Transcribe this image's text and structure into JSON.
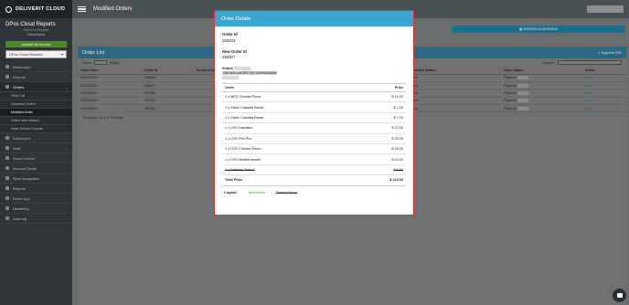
{
  "sidebar": {
    "brand": "DELIVERIT CLOUD",
    "profile_name": "DPos Cloud Reports",
    "profile_sub": "Switch to Reseller",
    "profile_role": "Client Admin",
    "activate_btn": "Activate Vet Account",
    "store_select": "DPos Cloud Reports",
    "items": [
      {
        "label": "Dashboard"
      },
      {
        "label": "Reports"
      },
      {
        "label": "Orders"
      },
      {
        "label": "HSM Call"
      },
      {
        "label": "Canceled Orders"
      },
      {
        "label": "Modified Order"
      },
      {
        "label": "Online Item Search"
      },
      {
        "label": "Make Screen Reports"
      },
      {
        "label": "Customers"
      },
      {
        "label": "Staff"
      },
      {
        "label": "Stock Control"
      },
      {
        "label": "Account Detail"
      },
      {
        "label": "Sync Integration"
      },
      {
        "label": "Reports"
      },
      {
        "label": "Driver App"
      },
      {
        "label": "Marketing"
      },
      {
        "label": "Catering"
      }
    ]
  },
  "topbar": {
    "title": "Modified Orders"
  },
  "content": {
    "date_strip": "▣ 9/09/2024 to 16/09/2024",
    "list_title": "Order List",
    "export_label": "⇩ Export to CSV",
    "show_label": "Show",
    "show_value": "10",
    "entries_label": "Rows",
    "search_label": "Search:",
    "columns": [
      "Order Date",
      "Order Id",
      "Tendered Amt",
      "",
      "",
      "",
      "",
      "Delivered By",
      "Transaction Status",
      "Store Name",
      "Action"
    ],
    "rows": [
      {
        "date": "16/05/2024",
        "id": "258303",
        "status": "Modified",
        "store": "Pizzeria",
        "action": "view"
      },
      {
        "date": "14/05/2024",
        "id": "258517",
        "status": "Modified",
        "store": "Pizzeria",
        "action": "view"
      },
      {
        "date": "12/05/2024",
        "id": "257989",
        "status": "Modified",
        "store": "Pizzeria",
        "action": "view"
      },
      {
        "date": "03/05/2024",
        "id": "257343",
        "status": "Modified",
        "store": "Pizzeria",
        "action": "view"
      },
      {
        "date": "01/05/2024",
        "id": "257151",
        "status": "Modified",
        "store": "Pizzeria",
        "action": "view"
      }
    ],
    "footer": "Showing 1 to 5 of 5 entries"
  },
  "modal": {
    "title": "Order Details",
    "order_id_label": "Order Id",
    "order_id": "258303",
    "new_order_id_label": "New Order Id",
    "new_order_id": "258307",
    "sharer_label": "Sharer",
    "sharer_address": "145 WILLMONG RD CARINGBAH",
    "col_order": "Order",
    "col_price": "Price",
    "items": [
      {
        "name": "1 x MED Cheese Pizza",
        "price": "$ 14.00",
        "deleted": false
      },
      {
        "name": "1 x Garlic Ciabatta Bread",
        "price": "$ 7.00",
        "deleted": false
      },
      {
        "name": "1 x Garlic Ciabatta Bread",
        "price": "$ 7.00",
        "deleted": false
      },
      {
        "name": "1 x LRG Hawaiian",
        "price": "$ 22.00",
        "deleted": false
      },
      {
        "name": "1 x LRG Peri Peri",
        "price": "$ 25.00",
        "deleted": false
      },
      {
        "name": "1 x LRG Chicken Pesto",
        "price": "$ 25.00",
        "deleted": false
      },
      {
        "name": "1 x LRG Mediterranean",
        "price": "$ 24.00",
        "deleted": false
      },
      {
        "name": "1 x Delivery Zone 1",
        "price": "$ 6.00",
        "deleted": true
      }
    ],
    "total_label": "Total Price",
    "total_value": "$ 124.00",
    "legend_title": "Legend:",
    "legend_new": "New Items",
    "legend_deleted": "Deleted Items"
  },
  "colors": {
    "accent": "#3aa6cd",
    "modal_border": "#e03333",
    "new_item": "#4a9a2a"
  }
}
